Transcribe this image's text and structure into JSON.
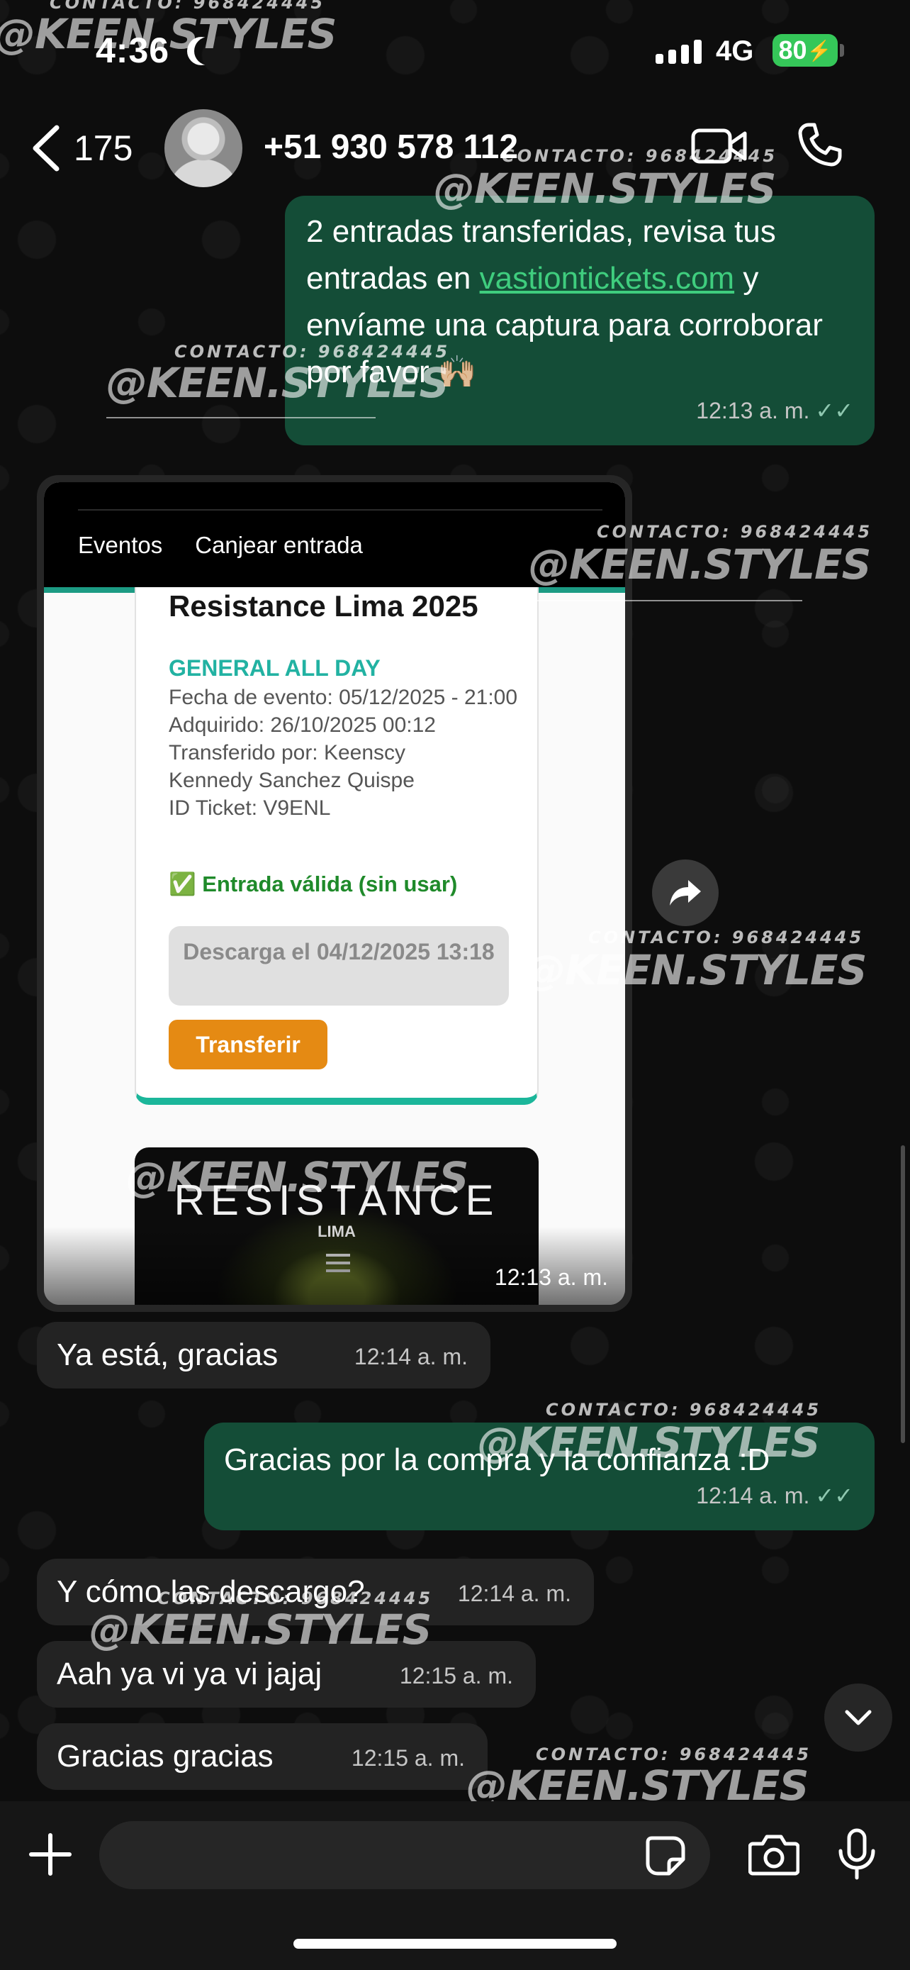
{
  "status_bar": {
    "time": "4:36",
    "network": "4G",
    "battery": "80"
  },
  "header": {
    "back_count": "175",
    "contact": "+51 930 578 112"
  },
  "messages": [
    {
      "dir": "out",
      "text_before": "2 entradas transferidas, revisa tus entradas en ",
      "link": "vastiontickets.com",
      "text_after": " y envíame una captura para corroborar por favor 🙌🏼",
      "time": "12:13 a. m."
    },
    {
      "dir": "in",
      "type": "image",
      "time": "12:13 a. m."
    },
    {
      "dir": "in",
      "text": "Ya está, gracias",
      "time": "12:14 a. m."
    },
    {
      "dir": "out",
      "text": "Gracias por la compra y la confianza :D",
      "time": "12:14 a. m."
    },
    {
      "dir": "in",
      "text": "Y cómo las descargo?",
      "time": "12:14 a. m."
    },
    {
      "dir": "in",
      "text": "Aah ya vi ya vi jajaj",
      "time": "12:15 a. m."
    },
    {
      "dir": "in",
      "text": "Gracias gracias",
      "time": "12:15 a. m."
    }
  ],
  "screenshot": {
    "nav": [
      "Eventos",
      "Canjear entrada"
    ],
    "title": "Resistance Lima 2025",
    "ticket_type": "GENERAL ALL DAY",
    "details": [
      "Fecha de evento: 05/12/2025 - 21:00",
      "Adquirido: 26/10/2025 00:12",
      "Transferido por: Keenscy",
      "Kennedy Sanchez Quispe",
      "ID Ticket: V9ENL"
    ],
    "valid": "✅ Entrada válida (sin usar)",
    "download": "Descarga el 04/12/2025 13:18",
    "transfer": "Transferir",
    "banner_title": "RESISTANCE",
    "banner_sub": "LIMA"
  },
  "watermark": {
    "handle": "@KEEN.STYLES",
    "contact": "CONTACTO: 968424445"
  },
  "colors": {
    "outgoing": "#144d37",
    "incoming": "#232323",
    "link": "#3fcd7e",
    "battery": "#35c759",
    "transfer": "#e58a13",
    "ticket_type": "#22b2a2"
  }
}
